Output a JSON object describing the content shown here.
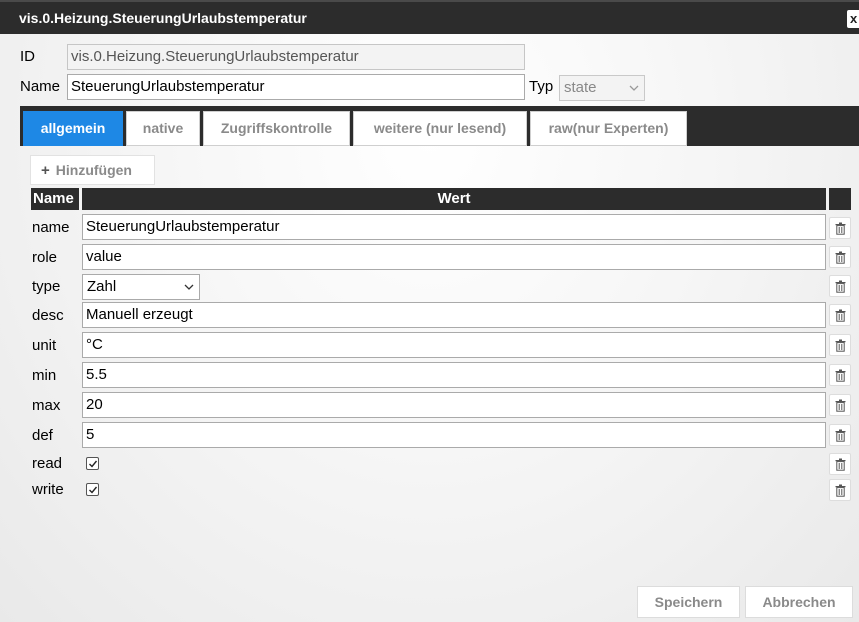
{
  "window": {
    "title": "vis.0.Heizung.SteuerungUrlaubstemperatur",
    "close_label": "x"
  },
  "header": {
    "id_label": "ID",
    "id_value": "vis.0.Heizung.SteuerungUrlaubstemperatur",
    "name_label": "Name",
    "name_value": "SteuerungUrlaubstemperatur",
    "typ_label": "Typ",
    "typ_value": "state"
  },
  "tabs": [
    {
      "label": "allgemein",
      "active": true
    },
    {
      "label": "native",
      "active": false
    },
    {
      "label": "Zugriffskontrolle",
      "active": false
    },
    {
      "label": "weitere (nur lesend)",
      "active": false
    },
    {
      "label": "raw(nur Experten)",
      "active": false
    }
  ],
  "toolbar": {
    "add_icon": "+",
    "add_label": "Hinzufügen"
  },
  "table": {
    "col_name": "Name",
    "col_value": "Wert",
    "rows": [
      {
        "name": "name",
        "value": "SteuerungUrlaubstemperatur",
        "kind": "text"
      },
      {
        "name": "role",
        "value": "value",
        "kind": "text"
      },
      {
        "name": "type",
        "value": "Zahl",
        "kind": "select"
      },
      {
        "name": "desc",
        "value": "Manuell erzeugt",
        "kind": "text"
      },
      {
        "name": "unit",
        "value": "°C",
        "kind": "text"
      },
      {
        "name": "min",
        "value": "5.5",
        "kind": "text"
      },
      {
        "name": "max",
        "value": "20",
        "kind": "text"
      },
      {
        "name": "def",
        "value": "5",
        "kind": "text"
      },
      {
        "name": "read",
        "checked": true,
        "kind": "checkbox"
      },
      {
        "name": "write",
        "checked": true,
        "kind": "checkbox"
      }
    ]
  },
  "footer": {
    "save_label": "Speichern",
    "cancel_label": "Abbrechen"
  },
  "colors": {
    "titlebar": "#2c2c2c",
    "accent": "#1e88e5",
    "muted_text": "#8a8a8a"
  },
  "icons": {
    "close": "close-icon",
    "add": "plus-icon",
    "delete": "trash-icon",
    "dropdown": "chevron-down-icon",
    "check": "checkmark-icon"
  }
}
